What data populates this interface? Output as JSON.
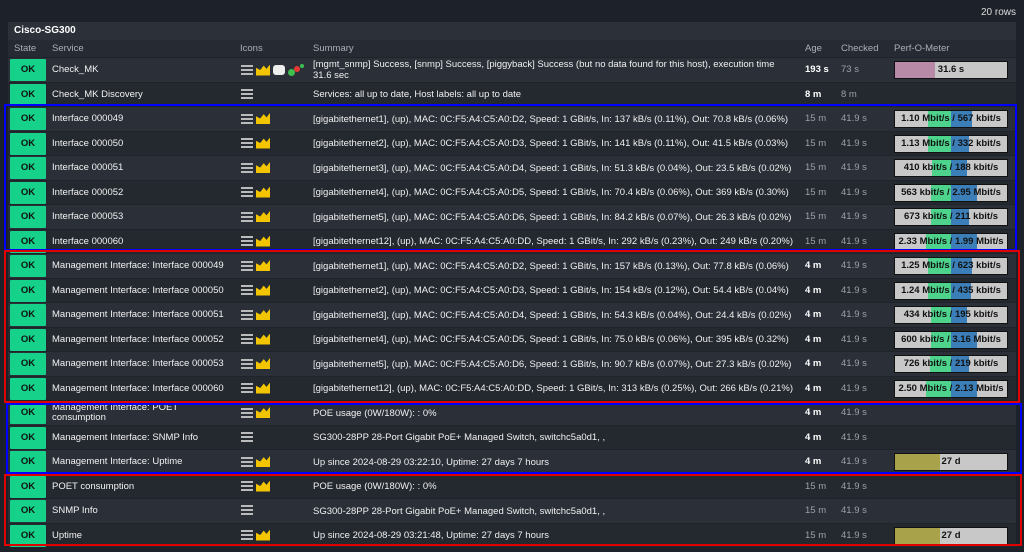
{
  "row_count": "20 rows",
  "host": "Cisco-SG300",
  "columns": {
    "state": "State",
    "service": "Service",
    "icons": "Icons",
    "summary": "Summary",
    "age": "Age",
    "checked": "Checked",
    "perf": "Perf-O-Meter"
  },
  "colors": {
    "ok": "#15d189",
    "in": "#4dd38c",
    "out": "#3c7fb8",
    "time": "#b88aa7",
    "uptime": "#a8a34a",
    "blue_box": "#0000ff",
    "red_box": "#e00000"
  },
  "rows": [
    {
      "state": "OK",
      "service": "Check_MK",
      "icons": [
        "menu-icon",
        "graph-icon",
        "comment-icon",
        "topology-icon"
      ],
      "summary": "[mgmt_snmp] Success, [snmp] Success, [piggyback] Success (but no data found for this host), execution time 31.6 sec",
      "age": "193 s",
      "age_bold": true,
      "checked": "73 s",
      "perf": {
        "type": "single",
        "label": "31.6 s",
        "fill": 0.36,
        "color": "#b88aa7"
      }
    },
    {
      "state": "OK",
      "service": "Check_MK Discovery",
      "icons": [
        "menu-icon"
      ],
      "summary": "Services: all up to date, Host labels: all up to date",
      "age": "8 m",
      "age_bold": true,
      "checked": "8 m"
    },
    {
      "state": "OK",
      "service": "Interface 000049",
      "icons": [
        "menu-icon",
        "graph-icon"
      ],
      "summary": "[gigabitethernet1], (up), MAC: 0C:F5:A4:C5:A0:D2, Speed: 1 GBit/s, In: 137 kB/s (0.11%), Out: 70.8 kB/s (0.06%)",
      "age": "15 m",
      "checked": "41.9 s",
      "perf": {
        "type": "io",
        "label": "1.10 Mbit/s / 567 kbit/s",
        "in": 0.41,
        "out": 0.37
      }
    },
    {
      "state": "OK",
      "service": "Interface 000050",
      "icons": [
        "menu-icon",
        "graph-icon"
      ],
      "summary": "[gigabitethernet2], (up), MAC: 0C:F5:A4:C5:A0:D3, Speed: 1 GBit/s, In: 141 kB/s (0.11%), Out: 41.5 kB/s (0.03%)",
      "age": "15 m",
      "checked": "41.9 s",
      "perf": {
        "type": "io",
        "label": "1.13 Mbit/s / 332 kbit/s",
        "in": 0.41,
        "out": 0.33
      }
    },
    {
      "state": "OK",
      "service": "Interface 000051",
      "icons": [
        "menu-icon",
        "graph-icon"
      ],
      "summary": "[gigabitethernet3], (up), MAC: 0C:F5:A4:C5:A0:D4, Speed: 1 GBit/s, In: 51.3 kB/s (0.04%), Out: 23.5 kB/s (0.02%)",
      "age": "15 m",
      "checked": "41.9 s",
      "perf": {
        "type": "io",
        "label": "410 kbit/s / 188 kbit/s",
        "in": 0.34,
        "out": 0.28
      }
    },
    {
      "state": "OK",
      "service": "Interface 000052",
      "icons": [
        "menu-icon",
        "graph-icon"
      ],
      "summary": "[gigabitethernet4], (up), MAC: 0C:F5:A4:C5:A0:D5, Speed: 1 GBit/s, In: 70.4 kB/s (0.06%), Out: 369 kB/s (0.30%)",
      "age": "15 m",
      "checked": "41.9 s",
      "perf": {
        "type": "io",
        "label": "563 kbit/s / 2.95 Mbit/s",
        "in": 0.35,
        "out": 0.47
      }
    },
    {
      "state": "OK",
      "service": "Interface 000053",
      "icons": [
        "menu-icon",
        "graph-icon"
      ],
      "summary": "[gigabitethernet5], (up), MAC: 0C:F5:A4:C5:A0:D6, Speed: 1 GBit/s, In: 84.2 kB/s (0.07%), Out: 26.3 kB/s (0.02%)",
      "age": "15 m",
      "checked": "41.9 s",
      "perf": {
        "type": "io",
        "label": "673 kbit/s / 211 kbit/s",
        "in": 0.35,
        "out": 0.33
      }
    },
    {
      "state": "OK",
      "service": "Interface 000060",
      "icons": [
        "menu-icon",
        "graph-icon"
      ],
      "summary": "[gigabitethernet12], (up), MAC: 0C:F5:A4:C5:A0:DD, Speed: 1 GBit/s, In: 292 kB/s (0.23%), Out: 249 kB/s (0.20%)",
      "age": "15 m",
      "checked": "41.9 s",
      "perf": {
        "type": "io",
        "label": "2.33 Mbit/s / 1.99 Mbit/s",
        "in": 0.44,
        "out": 0.46
      }
    },
    {
      "state": "OK",
      "service": "Management Interface: Interface 000049",
      "icons": [
        "menu-icon",
        "graph-icon"
      ],
      "summary": "[gigabitethernet1], (up), MAC: 0C:F5:A4:C5:A0:D2, Speed: 1 GBit/s, In: 157 kB/s (0.13%), Out: 77.8 kB/s (0.06%)",
      "age": "4 m",
      "age_bold": true,
      "checked": "41.9 s",
      "perf": {
        "type": "io",
        "label": "1.25 Mbit/s / 623 kbit/s",
        "in": 0.41,
        "out": 0.37
      }
    },
    {
      "state": "OK",
      "service": "Management Interface: Interface 000050",
      "icons": [
        "menu-icon",
        "graph-icon"
      ],
      "summary": "[gigabitethernet2], (up), MAC: 0C:F5:A4:C5:A0:D3, Speed: 1 GBit/s, In: 154 kB/s (0.12%), Out: 54.4 kB/s (0.04%)",
      "age": "4 m",
      "age_bold": true,
      "checked": "41.9 s",
      "perf": {
        "type": "io",
        "label": "1.24 Mbit/s / 435 kbit/s",
        "in": 0.41,
        "out": 0.35
      }
    },
    {
      "state": "OK",
      "service": "Management Interface: Interface 000051",
      "icons": [
        "menu-icon",
        "graph-icon"
      ],
      "summary": "[gigabitethernet3], (up), MAC: 0C:F5:A4:C5:A0:D4, Speed: 1 GBit/s, In: 54.3 kB/s (0.04%), Out: 24.4 kB/s (0.02%)",
      "age": "4 m",
      "age_bold": true,
      "checked": "41.9 s",
      "perf": {
        "type": "io",
        "label": "434 kbit/s / 195 kbit/s",
        "in": 0.35,
        "out": 0.28
      }
    },
    {
      "state": "OK",
      "service": "Management Interface: Interface 000052",
      "icons": [
        "menu-icon",
        "graph-icon"
      ],
      "summary": "[gigabitethernet4], (up), MAC: 0C:F5:A4:C5:A0:D5, Speed: 1 GBit/s, In: 75.0 kB/s (0.06%), Out: 395 kB/s (0.32%)",
      "age": "4 m",
      "age_bold": true,
      "checked": "41.9 s",
      "perf": {
        "type": "io",
        "label": "600 kbit/s / 3.16 Mbit/s",
        "in": 0.35,
        "out": 0.47
      }
    },
    {
      "state": "OK",
      "service": "Management Interface: Interface 000053",
      "icons": [
        "menu-icon",
        "graph-icon"
      ],
      "summary": "[gigabitethernet5], (up), MAC: 0C:F5:A4:C5:A0:D6, Speed: 1 GBit/s, In: 90.7 kB/s (0.07%), Out: 27.3 kB/s (0.02%)",
      "age": "4 m",
      "age_bold": true,
      "checked": "41.9 s",
      "perf": {
        "type": "io",
        "label": "726 kbit/s / 219 kbit/s",
        "in": 0.37,
        "out": 0.32
      }
    },
    {
      "state": "OK",
      "service": "Management Interface: Interface 000060",
      "icons": [
        "menu-icon",
        "graph-icon"
      ],
      "summary": "[gigabitethernet12], (up), MAC: 0C:F5:A4:C5:A0:DD, Speed: 1 GBit/s, In: 313 kB/s (0.25%), Out: 266 kB/s (0.21%)",
      "age": "4 m",
      "age_bold": true,
      "checked": "41.9 s",
      "perf": {
        "type": "io",
        "label": "2.50 Mbit/s / 2.13 Mbit/s",
        "in": 0.44,
        "out": 0.46
      }
    },
    {
      "state": "OK",
      "service": "Management Interface: POET consumption",
      "icons": [
        "menu-icon",
        "graph-icon"
      ],
      "summary": "POE usage (0W/180W): : 0%",
      "age": "4 m",
      "age_bold": true,
      "checked": "41.9 s"
    },
    {
      "state": "OK",
      "service": "Management Interface: SNMP Info",
      "icons": [
        "menu-icon"
      ],
      "summary": "SG300-28PP 28-Port Gigabit PoE+ Managed Switch, switchc5a0d1, ,",
      "age": "4 m",
      "age_bold": true,
      "checked": "41.9 s"
    },
    {
      "state": "OK",
      "service": "Management Interface: Uptime",
      "icons": [
        "menu-icon",
        "graph-icon"
      ],
      "summary": "Up since 2024-08-29 03:22:10, Uptime: 27 days 7 hours",
      "age": "4 m",
      "age_bold": true,
      "checked": "41.9 s",
      "perf": {
        "type": "single",
        "label": "27 d",
        "fill": 0.4,
        "color": "#a8a34a"
      }
    },
    {
      "state": "OK",
      "service": "POET consumption",
      "icons": [
        "menu-icon",
        "graph-icon"
      ],
      "summary": "POE usage (0W/180W): : 0%",
      "age": "15 m",
      "checked": "41.9 s"
    },
    {
      "state": "OK",
      "service": "SNMP Info",
      "icons": [
        "menu-icon"
      ],
      "summary": "SG300-28PP 28-Port Gigabit PoE+ Managed Switch, switchc5a0d1, ,",
      "age": "15 m",
      "checked": "41.9 s"
    },
    {
      "state": "OK",
      "service": "Uptime",
      "icons": [
        "menu-icon",
        "graph-icon"
      ],
      "summary": "Up since 2024-08-29 03:21:48, Uptime: 27 days 7 hours",
      "age": "15 m",
      "checked": "41.9 s",
      "perf": {
        "type": "single",
        "label": "27 d",
        "fill": 0.4,
        "color": "#a8a34a"
      }
    }
  ]
}
